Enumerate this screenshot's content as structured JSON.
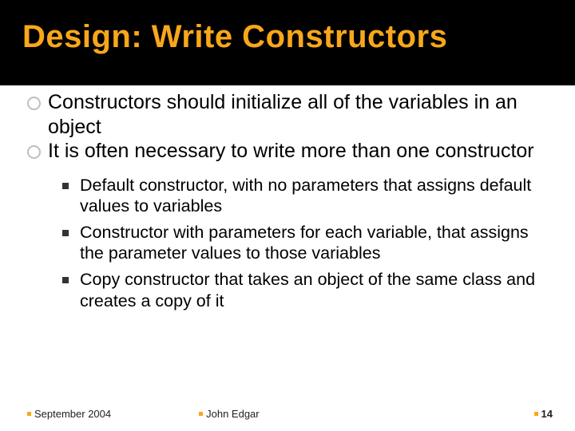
{
  "header": {
    "title": "Design: Write Constructors"
  },
  "bullets": {
    "primary": [
      "Constructors should initialize all of the variables in an object",
      "It is often necessary to write more than one constructor"
    ],
    "secondary": [
      "Default constructor, with no parameters that assigns default values to variables",
      "Constructor with parameters for each variable, that assigns the parameter values to those variables",
      "Copy constructor that takes an object of the same class and creates a copy of it"
    ]
  },
  "footer": {
    "date": "September 2004",
    "author": "John Edgar",
    "page": "14"
  }
}
